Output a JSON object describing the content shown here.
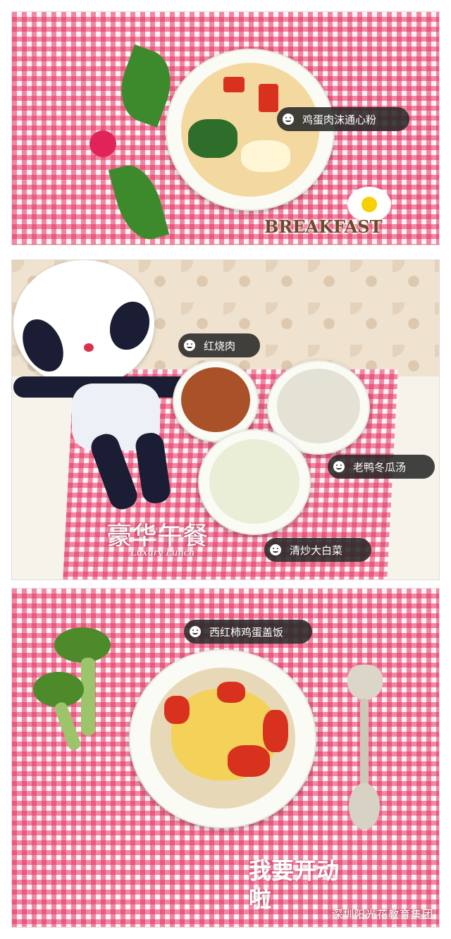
{
  "panels": [
    {
      "id": "breakfast",
      "dish_labels": [
        "鸡蛋肉沫通心粉"
      ],
      "banner_text": "BREAKFAST"
    },
    {
      "id": "lunch",
      "dish_labels": [
        "红烧肉",
        "老鸭冬瓜汤",
        "清炒大白菜"
      ],
      "title_text": "豪华午餐",
      "subtitle_text": "Luxury Lunch"
    },
    {
      "id": "dinner",
      "dish_labels": [
        "西红柿鸡蛋盖饭"
      ],
      "handwritten_text": "我要开动啦"
    }
  ],
  "footer": {
    "text": "深圳阳光花教育集团"
  },
  "colors": {
    "gingham": "#e43060",
    "tag_bg": "#282828",
    "tomato": "#d8321e",
    "egg": "#f4d25a"
  },
  "icon_names": [
    "smile-face-icon"
  ]
}
